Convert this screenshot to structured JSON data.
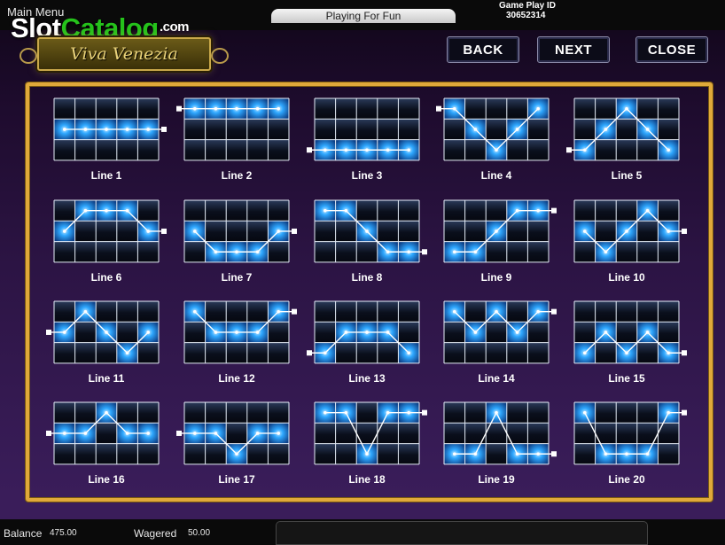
{
  "header": {
    "main_menu": "Main Menu",
    "watermark_slot": "Slot",
    "watermark_catalog": "Catalog",
    "watermark_com": ".com",
    "logo_text": "Viva Venezia",
    "mode": "Playing For Fun",
    "game_play_id_label": "Game Play ID",
    "game_play_id": "30652314"
  },
  "nav": {
    "back": "BACK",
    "next": "NEXT",
    "close": "CLOSE"
  },
  "colors": {
    "frame": "#e0a93a",
    "cell_light": "#2fa8ff",
    "background": "#2c1444"
  },
  "paylines": [
    {
      "label": "Line 1",
      "rows": [
        1,
        1,
        1,
        1,
        1
      ],
      "marker_side": "right"
    },
    {
      "label": "Line 2",
      "rows": [
        0,
        0,
        0,
        0,
        0
      ],
      "marker_side": "left"
    },
    {
      "label": "Line 3",
      "rows": [
        2,
        2,
        2,
        2,
        2
      ],
      "marker_side": "left"
    },
    {
      "label": "Line 4",
      "rows": [
        0,
        1,
        2,
        1,
        0
      ],
      "marker_side": "left"
    },
    {
      "label": "Line 5",
      "rows": [
        2,
        1,
        0,
        1,
        2
      ],
      "marker_side": "left"
    },
    {
      "label": "Line 6",
      "rows": [
        1,
        0,
        0,
        0,
        1
      ],
      "marker_side": "right"
    },
    {
      "label": "Line 7",
      "rows": [
        1,
        2,
        2,
        2,
        1
      ],
      "marker_side": "right"
    },
    {
      "label": "Line 8",
      "rows": [
        0,
        0,
        1,
        2,
        2
      ],
      "marker_side": "right"
    },
    {
      "label": "Line 9",
      "rows": [
        2,
        2,
        1,
        0,
        0
      ],
      "marker_side": "right"
    },
    {
      "label": "Line 10",
      "rows": [
        1,
        2,
        1,
        0,
        1
      ],
      "marker_side": "right"
    },
    {
      "label": "Line 11",
      "rows": [
        1,
        0,
        1,
        2,
        1
      ],
      "marker_side": "left"
    },
    {
      "label": "Line 12",
      "rows": [
        0,
        1,
        1,
        1,
        0
      ],
      "marker_side": "right"
    },
    {
      "label": "Line 13",
      "rows": [
        2,
        1,
        1,
        1,
        2
      ],
      "marker_side": "left"
    },
    {
      "label": "Line 14",
      "rows": [
        0,
        1,
        0,
        1,
        0
      ],
      "marker_side": "right"
    },
    {
      "label": "Line 15",
      "rows": [
        2,
        1,
        2,
        1,
        2
      ],
      "marker_side": "right"
    },
    {
      "label": "Line 16",
      "rows": [
        1,
        1,
        0,
        1,
        1
      ],
      "marker_side": "left"
    },
    {
      "label": "Line 17",
      "rows": [
        1,
        1,
        2,
        1,
        1
      ],
      "marker_side": "left"
    },
    {
      "label": "Line 18",
      "rows": [
        0,
        0,
        2,
        0,
        0
      ],
      "marker_side": "right"
    },
    {
      "label": "Line 19",
      "rows": [
        2,
        2,
        0,
        2,
        2
      ],
      "marker_side": "right"
    },
    {
      "label": "Line 20",
      "rows": [
        0,
        2,
        2,
        2,
        0
      ],
      "marker_side": "right"
    }
  ],
  "footer": {
    "balance_label": "Balance",
    "balance": "475.00",
    "wagered_label": "Wagered",
    "wagered": "50.00"
  }
}
